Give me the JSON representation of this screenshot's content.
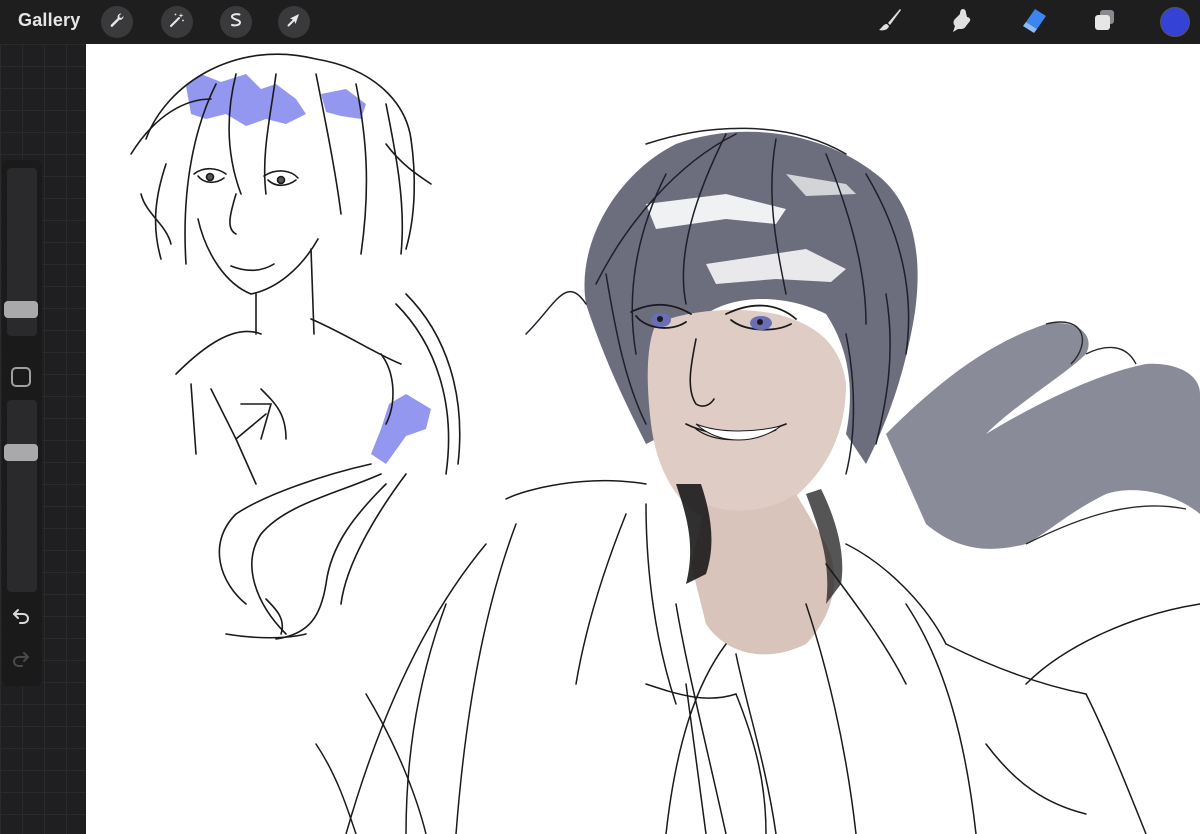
{
  "topbar": {
    "gallery_label": "Gallery",
    "left_tools": [
      "wrench-icon",
      "magic-wand-icon",
      "selection-icon",
      "transform-arrow-icon"
    ],
    "right_tools": [
      "brush-icon",
      "smudge-icon",
      "eraser-icon",
      "layers-icon"
    ],
    "active_tool": "eraser",
    "current_color": "#3442d6"
  },
  "sidebar": {
    "brush_size": 0.12,
    "opacity": 0.75
  },
  "colors": {
    "accent": "#3a85f0",
    "hair_gray": "#6e7080",
    "hair_blue_highlight": "#6f74ea",
    "skin": "#d9c6bf"
  }
}
